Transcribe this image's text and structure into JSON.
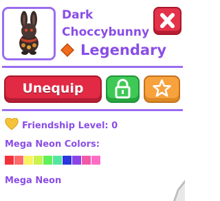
{
  "pet": {
    "name": "Dark Choccybunny",
    "rarity": "Legendary",
    "image": "dark-choccybunny-pet"
  },
  "actions": {
    "close_icon": "close-x-icon",
    "unequip_label": "Unequip",
    "lock_icon": "lock-icon",
    "favorite_icon": "star-icon"
  },
  "friendship": {
    "icon": "heart-icon",
    "text": "Friendship Level: 0"
  },
  "neon_colors": {
    "label": "Mega Neon Colors:",
    "swatches": [
      "#f2323b",
      "#ff6a6a",
      "#f9f35e",
      "#c8f24e",
      "#5ff05a",
      "#54e6a0",
      "#2b35e0",
      "#8b45e6",
      "#ef5aa8",
      "#ff6ec4"
    ]
  },
  "neon_type": "Mega Neon",
  "colors": {
    "accent": "#8a4ee6",
    "border": "#9a6cf0",
    "red": "#e22a44",
    "green": "#3ec956",
    "orange": "#f7a23c"
  }
}
